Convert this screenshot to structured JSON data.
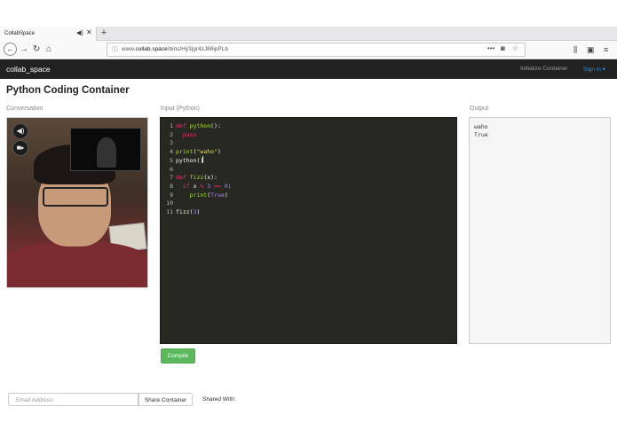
{
  "browser": {
    "tab_title": "CollabSpace",
    "tab_sound_icon": "speaker-icon",
    "tab_close": "✕",
    "new_tab": "+",
    "url_prefix": "www.",
    "url_domain": "collab.space",
    "url_path": "/bins/Hy3jgr4zJ88ipPLb",
    "url_more": "•••"
  },
  "app": {
    "brand": "collab_space",
    "nav_initialize": "Initialize Container",
    "nav_signin": "Sign in ▾",
    "page_title": "Python Coding Container",
    "conversation_label": "Conversation",
    "input_label": "Input (Python)",
    "output_label": "Output"
  },
  "editor": {
    "lines": [
      {
        "n": "1",
        "tokens": [
          [
            "kw",
            "def "
          ],
          [
            "fn",
            "python"
          ],
          [
            "tx",
            "():"
          ]
        ]
      },
      {
        "n": "2",
        "tokens": [
          [
            "tx",
            "  "
          ],
          [
            "kw",
            "pass"
          ]
        ]
      },
      {
        "n": "3",
        "tokens": []
      },
      {
        "n": "4",
        "tokens": [
          [
            "fn",
            "print"
          ],
          [
            "tx",
            "("
          ],
          [
            "st",
            "\"waho\""
          ],
          [
            "tx",
            ")"
          ]
        ]
      },
      {
        "n": "5",
        "tokens": [
          [
            "tx",
            "python()"
          ]
        ]
      },
      {
        "n": "6",
        "tokens": []
      },
      {
        "n": "7",
        "tokens": [
          [
            "kw",
            "def "
          ],
          [
            "fn",
            "fizz"
          ],
          [
            "tx",
            "(x):"
          ]
        ]
      },
      {
        "n": "8",
        "tokens": [
          [
            "tx",
            "  "
          ],
          [
            "kw",
            "if "
          ],
          [
            "tx",
            "x "
          ],
          [
            "op",
            "% "
          ],
          [
            "nm",
            "3 "
          ],
          [
            "op",
            "== "
          ],
          [
            "nm",
            "0"
          ],
          [
            "tx",
            ":"
          ]
        ]
      },
      {
        "n": "9",
        "tokens": [
          [
            "tx",
            "    "
          ],
          [
            "fn",
            "print"
          ],
          [
            "tx",
            "("
          ],
          [
            "nm",
            "True"
          ],
          [
            "tx",
            ")"
          ]
        ]
      },
      {
        "n": "10",
        "tokens": []
      },
      {
        "n": "11",
        "tokens": [
          [
            "tx",
            "fizz("
          ],
          [
            "nm",
            "3"
          ],
          [
            "tx",
            ")"
          ]
        ]
      }
    ]
  },
  "output": {
    "lines": [
      "waho",
      "True"
    ]
  },
  "buttons": {
    "compile": "Compile",
    "share": "Share Container"
  },
  "share": {
    "email_placeholder": "Email Address",
    "shared_with_label": "Shared With:"
  },
  "colors": {
    "navbar_bg": "#222222",
    "editor_bg": "#272822",
    "compile_green": "#5cb85c",
    "signin_blue": "#2a8ad8"
  }
}
